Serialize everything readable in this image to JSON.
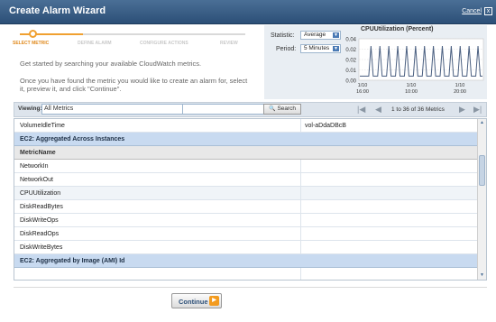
{
  "window": {
    "title": "Create Alarm Wizard",
    "cancel_label": "Cancel",
    "close_glyph": "x"
  },
  "steps": [
    {
      "label": "SELECT METRIC",
      "active": true
    },
    {
      "label": "DEFINE ALARM",
      "active": false
    },
    {
      "label": "CONFIGURE ACTIONS",
      "active": false
    },
    {
      "label": "REVIEW",
      "active": false
    }
  ],
  "intro": {
    "line1": "Get started by searching your available CloudWatch metrics.",
    "line2": "Once you have found the metric you would like to create an alarm for, select it, preview it, and click \"Continue\"."
  },
  "preview": {
    "statistic_label": "Statistic:",
    "statistic_value": "Average",
    "period_label": "Period:",
    "period_value": "5 Minutes"
  },
  "chart_data": {
    "type": "line",
    "title": "CPUUtilization (Percent)",
    "yticks": [
      "0.04",
      "0.02",
      "0.02",
      "0.01",
      "0.00"
    ],
    "ylim": [
      0,
      0.04
    ],
    "xticks": [
      [
        "1/10",
        "16:00"
      ],
      [
        "1/10",
        "10:00"
      ],
      [
        "1/10",
        "20:00"
      ]
    ],
    "grid": true,
    "color": "#4a5f80",
    "values": [
      0.004,
      0.004,
      0.004,
      0.004,
      0.004,
      0.033,
      0.004,
      0.004,
      0.004,
      0.033,
      0.004,
      0.004,
      0.004,
      0.033,
      0.004,
      0.004,
      0.004,
      0.033,
      0.004,
      0.004,
      0.004,
      0.033,
      0.004,
      0.004,
      0.004,
      0.033,
      0.004,
      0.004,
      0.004,
      0.033,
      0.004,
      0.004,
      0.004,
      0.033,
      0.004,
      0.004,
      0.004,
      0.033,
      0.004,
      0.004,
      0.004,
      0.033,
      0.004,
      0.004,
      0.004,
      0.033,
      0.004,
      0.004,
      0.004,
      0.033,
      0.004,
      0.004,
      0.004,
      0.033,
      0.004,
      0.004
    ]
  },
  "toolbar": {
    "viewing_label": "Viewing:",
    "viewing_value": "All Metrics",
    "search_value": "",
    "search_button": "Search",
    "first_glyph": "|◀",
    "prev_glyph": "◀",
    "next_glyph": "▶",
    "last_glyph": "▶|",
    "pager_text": "1 to 36 of 36 Metrics"
  },
  "grid": {
    "rows": [
      {
        "kind": "data",
        "c1": "VolumeIdleTime",
        "c2": "vol-aDdaDBcB"
      },
      {
        "kind": "group",
        "c1": "EC2: Aggregated Across Instances",
        "c2": ""
      },
      {
        "kind": "header",
        "c1": "MetricName",
        "c2": ""
      },
      {
        "kind": "data",
        "c1": "NetworkIn",
        "c2": ""
      },
      {
        "kind": "data",
        "c1": "NetworkOut",
        "c2": ""
      },
      {
        "kind": "data",
        "c1": "CPUUtilization",
        "c2": ""
      },
      {
        "kind": "data",
        "c1": "DiskReadBytes",
        "c2": ""
      },
      {
        "kind": "data",
        "c1": "DiskWriteOps",
        "c2": ""
      },
      {
        "kind": "data",
        "c1": "DiskReadOps",
        "c2": ""
      },
      {
        "kind": "data",
        "c1": "DiskWriteBytes",
        "c2": ""
      },
      {
        "kind": "group",
        "c1": "EC2: Aggregated by Image (AMI) Id",
        "c2": ""
      }
    ]
  },
  "footer": {
    "continue_label": "Continue"
  }
}
